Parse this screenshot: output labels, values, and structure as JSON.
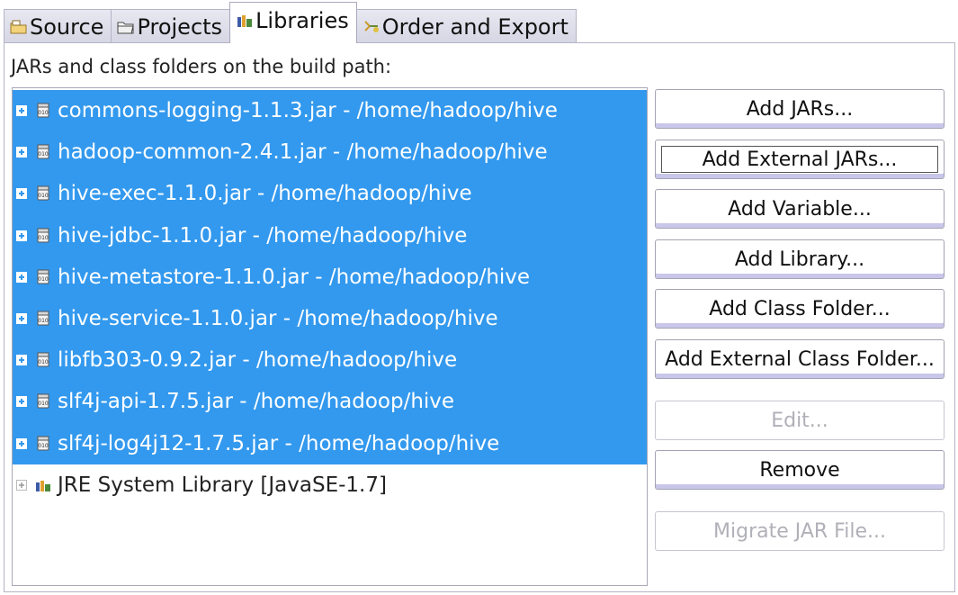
{
  "tabs": [
    {
      "label": "Source",
      "icon": "source-folder-icon",
      "active": false
    },
    {
      "label": "Projects",
      "icon": "folder-icon",
      "active": false
    },
    {
      "label": "Libraries",
      "icon": "library-icon",
      "active": true
    },
    {
      "label": "Order and Export",
      "icon": "order-export-icon",
      "active": false
    }
  ],
  "caption": "JARs and class folders on the build path:",
  "entries": [
    {
      "label": "commons-logging-1.1.3.jar - /home/hadoop/hive",
      "icon": "jar-icon",
      "selected": true
    },
    {
      "label": "hadoop-common-2.4.1.jar - /home/hadoop/hive",
      "icon": "jar-icon",
      "selected": true
    },
    {
      "label": "hive-exec-1.1.0.jar - /home/hadoop/hive",
      "icon": "jar-icon",
      "selected": true
    },
    {
      "label": "hive-jdbc-1.1.0.jar - /home/hadoop/hive",
      "icon": "jar-icon",
      "selected": true
    },
    {
      "label": "hive-metastore-1.1.0.jar - /home/hadoop/hive",
      "icon": "jar-icon",
      "selected": true
    },
    {
      "label": "hive-service-1.1.0.jar - /home/hadoop/hive",
      "icon": "jar-icon",
      "selected": true
    },
    {
      "label": "libfb303-0.9.2.jar - /home/hadoop/hive",
      "icon": "jar-icon",
      "selected": true
    },
    {
      "label": "slf4j-api-1.7.5.jar - /home/hadoop/hive",
      "icon": "jar-icon",
      "selected": true
    },
    {
      "label": "slf4j-log4j12-1.7.5.jar - /home/hadoop/hive",
      "icon": "jar-icon",
      "selected": true
    },
    {
      "label": "JRE System Library [JavaSE-1.7]",
      "icon": "jre-library-icon",
      "selected": false
    }
  ],
  "buttons": {
    "add_jars": {
      "label": "Add JARs...",
      "enabled": true
    },
    "add_external_jars": {
      "label": "Add External JARs...",
      "enabled": true,
      "focused": true
    },
    "add_variable": {
      "label": "Add Variable...",
      "enabled": true
    },
    "add_library": {
      "label": "Add Library...",
      "enabled": true
    },
    "add_class_folder": {
      "label": "Add Class Folder...",
      "enabled": true
    },
    "add_external_class_folder": {
      "label": "Add External Class Folder...",
      "enabled": true
    },
    "edit": {
      "label": "Edit...",
      "enabled": false
    },
    "remove": {
      "label": "Remove",
      "enabled": true
    },
    "migrate_jar_file": {
      "label": "Migrate JAR File...",
      "enabled": false
    }
  },
  "colors": {
    "selection": "#3399ee",
    "button_accent": "#c9c6ea",
    "disabled_text": "#b0b0b8"
  }
}
